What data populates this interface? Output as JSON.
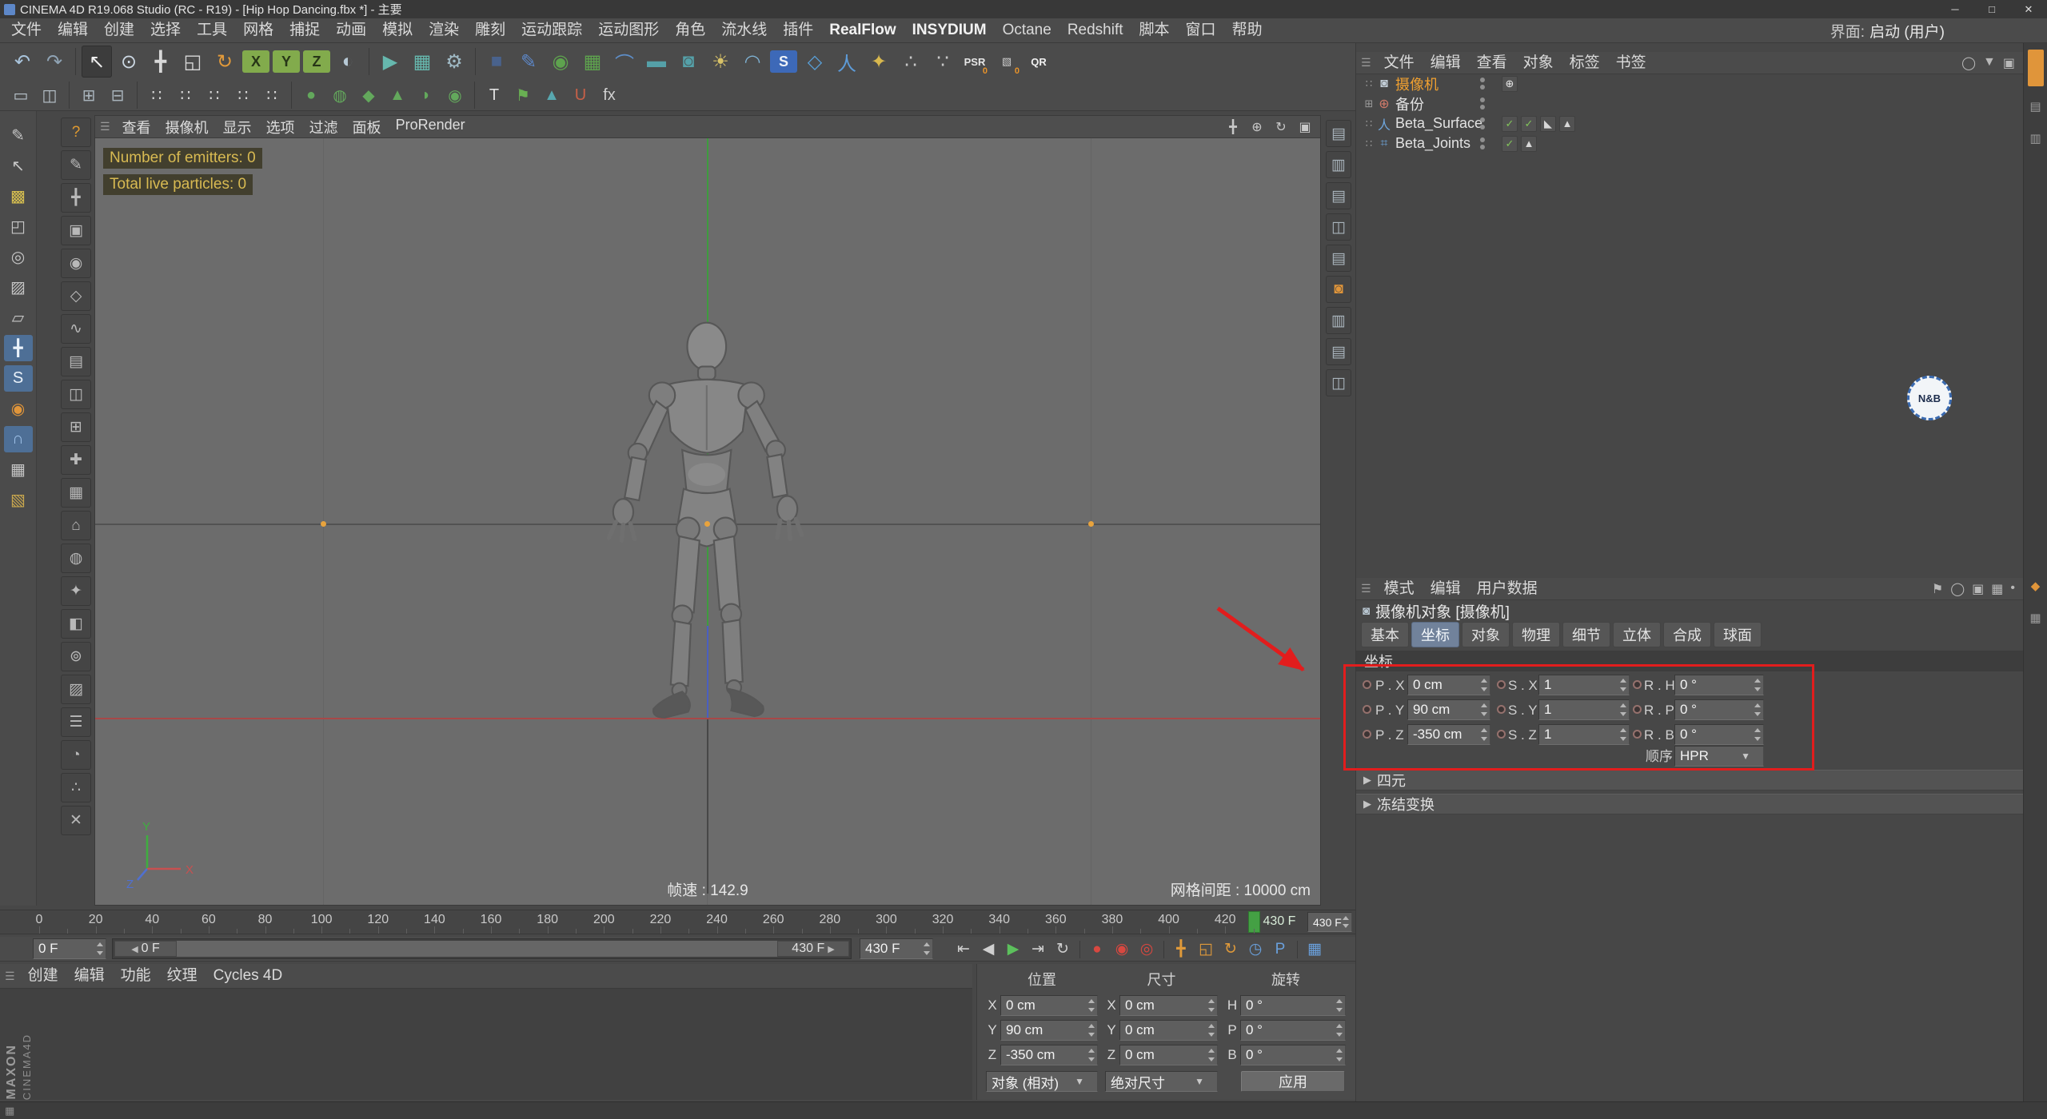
{
  "window": {
    "title": "CINEMA 4D R19.068 Studio (RC - R19) - [Hip Hop Dancing.fbx *] - 主要",
    "buttons": [
      {
        "n": "minimize-button",
        "g": "─"
      },
      {
        "n": "maximize-button",
        "g": "□"
      },
      {
        "n": "close-button",
        "g": "✕"
      }
    ]
  },
  "menubar": {
    "items": [
      "文件",
      "编辑",
      "创建",
      "选择",
      "工具",
      "网格",
      "捕捉",
      "动画",
      "模拟",
      "渲染",
      "雕刻",
      "运动跟踪",
      "运动图形",
      "角色",
      "流水线",
      "插件",
      "RealFlow",
      "INSYDIUM",
      "Octane",
      "Redshift",
      "脚本",
      "窗口",
      "帮助"
    ],
    "emphasis": [
      "RealFlow",
      "INSYDIUM"
    ],
    "interface_label": "界面:",
    "interface_value": "启动 (用户)"
  },
  "toolbar_row1": [
    {
      "n": "undo-icon",
      "g": "↶",
      "c": "#a9c4dc"
    },
    {
      "n": "redo-icon",
      "g": "↷",
      "c": "#8fa3b4"
    },
    {
      "sep": 1
    },
    {
      "n": "select-tool-icon",
      "g": "↖",
      "c": "#f0f0f0",
      "active": 1
    },
    {
      "n": "live-selection-icon",
      "g": "⊙",
      "c": "#cdd9e4"
    },
    {
      "n": "move-tool-icon",
      "g": "╋",
      "c": "#d8d8d8"
    },
    {
      "n": "scale-tool-icon",
      "g": "◱",
      "c": "#d8d8d8"
    },
    {
      "n": "rotate-tool-icon",
      "g": "↻",
      "c": "#e29a3a"
    },
    {
      "n": "x-axis-lock-button",
      "g": "X",
      "bg": "#82ab4c",
      "c": "#273617",
      "btn": 1
    },
    {
      "n": "y-axis-lock-button",
      "g": "Y",
      "bg": "#82ab4c",
      "c": "#273617",
      "btn": 1
    },
    {
      "n": "z-axis-lock-button",
      "g": "Z",
      "bg": "#82ab4c",
      "c": "#273617",
      "btn": 1
    },
    {
      "n": "coordinate-system-icon",
      "g": "◐",
      "c": "#b7c9d6"
    },
    {
      "sep": 1
    },
    {
      "n": "render-view-icon",
      "g": "▶",
      "c": "#66b8ae"
    },
    {
      "n": "render-picture-viewer-icon",
      "g": "▦",
      "c": "#66b8ae"
    },
    {
      "n": "render-settings-icon",
      "g": "⚙",
      "c": "#9fb9c4"
    },
    {
      "sep": 1
    },
    {
      "n": "primitive-cube-icon",
      "g": "■",
      "c": "#49628c"
    },
    {
      "n": "spline-pen-icon",
      "g": "✎",
      "c": "#5d87c8"
    },
    {
      "n": "subdivision-surface-icon",
      "g": "◉",
      "c": "#5ea34e"
    },
    {
      "n": "array-generator-icon",
      "g": "▦",
      "c": "#5ea34e"
    },
    {
      "n": "deformer-icon",
      "g": "⌒",
      "c": "#5e8ec8"
    },
    {
      "n": "floor-object-icon",
      "g": "▬",
      "c": "#55a0a8"
    },
    {
      "n": "camera-object-icon",
      "g": "◙",
      "c": "#55a0a8"
    },
    {
      "n": "light-object-icon",
      "g": "☀",
      "c": "#d8c268"
    },
    {
      "n": "physical-sky-icon",
      "g": "◠",
      "c": "#7fb3d5"
    },
    {
      "n": "simulate-icon",
      "g": "S",
      "bg": "#3d69b8",
      "c": "#eef2f8",
      "btn": 1
    },
    {
      "n": "mograph-icon",
      "g": "◇",
      "c": "#59a0d8"
    },
    {
      "n": "character-object-icon",
      "g": "人",
      "c": "#5d9bd8"
    },
    {
      "n": "joint-tool-icon",
      "g": "✦",
      "c": "#d8b84e"
    },
    {
      "n": "partic​le-emitter-icon",
      "g": "∴",
      "c": "#c9c9c9"
    },
    {
      "n": "thinking-particles-icon",
      "g": "∵",
      "c": "#c9c9c9"
    },
    {
      "n": "psr-badge",
      "g": "PSR",
      "c": "#e6e6e6",
      "badge": 1,
      "sub": "0"
    },
    {
      "n": "xpresso-badge",
      "g": "▧",
      "c": "#cfcfcf",
      "badge": 1,
      "sub": "0"
    },
    {
      "n": "qr-badge",
      "g": "QR",
      "c": "#f0f0f0",
      "badge": 1
    }
  ],
  "toolbar_row2": [
    {
      "n": "layout-single-icon",
      "g": "▭",
      "c": "#b9c4cc"
    },
    {
      "n": "layout-split-icon",
      "g": "◫",
      "c": "#b9c4cc"
    },
    {
      "sep": 1
    },
    {
      "n": "interface-icon-1",
      "g": "⊞",
      "c": "#a9b4bc"
    },
    {
      "n": "interface-icon-2",
      "g": "⊟",
      "c": "#a9b4bc"
    },
    {
      "sep": 1
    },
    {
      "n": "selection-dots-icon-1",
      "g": "∷",
      "c": "#d8d8d8"
    },
    {
      "n": "selection-dots-icon-2",
      "g": "∷",
      "c": "#d8d8d8"
    },
    {
      "n": "selection-dots-icon-3",
      "g": "∷",
      "c": "#d8d8d8"
    },
    {
      "n": "selection-dots-icon-4",
      "g": "∷",
      "c": "#d8d8d8"
    },
    {
      "n": "selection-dots-icon-5",
      "g": "∷",
      "c": "#d8d8d8"
    },
    {
      "sep": 1
    },
    {
      "n": "modeling-preset-icon-1",
      "g": "●",
      "c": "#63a85c"
    },
    {
      "n": "modeling-preset-icon-2",
      "g": "◍",
      "c": "#63a85c"
    },
    {
      "n": "modeling-preset-icon-3",
      "g": "◆",
      "c": "#63a85c"
    },
    {
      "n": "modeling-preset-icon-4",
      "g": "▲",
      "c": "#63a85c"
    },
    {
      "n": "modeling-preset-icon-5",
      "g": "◗",
      "c": "#63a85c"
    },
    {
      "n": "modeling-preset-icon-6",
      "g": "◉",
      "c": "#63a85c"
    },
    {
      "sep": 1
    },
    {
      "n": "text-tool-icon",
      "g": "T",
      "c": "#e0e0e0"
    },
    {
      "n": "flag-icon",
      "g": "⚑",
      "c": "#69b053"
    },
    {
      "n": "cone-icon",
      "g": "▲",
      "c": "#58a8b0"
    },
    {
      "n": "snap-magnet-icon",
      "g": "U",
      "c": "#c86048"
    },
    {
      "n": "fx-icon",
      "g": "fx",
      "c": "#d0d0d0"
    }
  ],
  "left_toolbar": [
    {
      "n": "pen-tool-icon",
      "g": "✎"
    },
    {
      "n": "arrow-annotate-icon",
      "g": "↖"
    },
    {
      "n": "texture-paint-icon",
      "g": "▩",
      "c": "#d8c050"
    },
    {
      "n": "make-editable-icon",
      "g": "◰"
    },
    {
      "n": "model-mode-icon",
      "g": "◎"
    },
    {
      "n": "texture-mode-icon",
      "g": "▨"
    },
    {
      "n": "workplane-icon",
      "g": "▱"
    },
    {
      "n": "axis-mode-icon",
      "g": "╋",
      "active": 1
    },
    {
      "n": "solo-mode-icon",
      "g": "S",
      "active": 1
    },
    {
      "n": "viewport-solo-icon",
      "g": "◉",
      "c": "#e0953a"
    },
    {
      "n": "snap-toggle-icon",
      "g": "∩",
      "active": 1,
      "c": "#9ec1e8"
    },
    {
      "n": "quantize-icon",
      "g": "▦"
    },
    {
      "n": "texture-tile-icon",
      "g": "▧",
      "c": "#caa84e"
    }
  ],
  "palette": [
    {
      "n": "palette-help-icon",
      "g": "?",
      "c": "#e09a30"
    },
    {
      "n": "palette-icon-2",
      "g": "✎"
    },
    {
      "n": "palette-icon-3",
      "g": "╋"
    },
    {
      "n": "palette-icon-4",
      "g": "▣"
    },
    {
      "n": "palette-icon-5",
      "g": "◉"
    },
    {
      "n": "palette-icon-6",
      "g": "◇"
    },
    {
      "n": "palette-icon-7",
      "g": "∿"
    },
    {
      "n": "palette-icon-8",
      "g": "▤"
    },
    {
      "n": "palette-icon-9",
      "g": "◫"
    },
    {
      "n": "palette-icon-10",
      "g": "⊞"
    },
    {
      "n": "palette-icon-11",
      "g": "✚"
    },
    {
      "n": "palette-icon-12",
      "g": "▦"
    },
    {
      "n": "palette-icon-13",
      "g": "⌂"
    },
    {
      "n": "palette-icon-14",
      "g": "◍"
    },
    {
      "n": "palette-icon-15",
      "g": "✦"
    },
    {
      "n": "palette-icon-16",
      "g": "◧"
    },
    {
      "n": "palette-icon-17",
      "g": "⊚"
    },
    {
      "n": "palette-icon-18",
      "g": "▨"
    },
    {
      "n": "palette-icon-19",
      "g": "☰"
    },
    {
      "n": "palette-icon-20",
      "g": "◔"
    },
    {
      "n": "palette-icon-21",
      "g": "∴"
    },
    {
      "n": "palette-icon-22",
      "g": "✕"
    }
  ],
  "side_strip": [
    {
      "n": "panel-tab-icon-1",
      "g": "▤"
    },
    {
      "n": "panel-tab-icon-2",
      "g": "▥"
    },
    {
      "n": "panel-tab-icon-3",
      "g": "▤"
    },
    {
      "n": "panel-tab-icon-4",
      "g": "◫"
    },
    {
      "n": "panel-tab-icon-5",
      "g": "▤"
    },
    {
      "n": "panel-tab-icon-6",
      "g": "◙",
      "c": "#e0953a"
    },
    {
      "n": "panel-tab-icon-7",
      "g": "▥"
    },
    {
      "n": "panel-tab-icon-8",
      "g": "▤"
    },
    {
      "n": "panel-tab-icon-9",
      "g": "◫"
    }
  ],
  "viewport": {
    "menu": [
      "查看",
      "摄像机",
      "显示",
      "选项",
      "过滤",
      "面板",
      "ProRender"
    ],
    "nav_icons": [
      {
        "n": "viewport-pan-icon",
        "g": "╋"
      },
      {
        "n": "viewport-zoom-icon",
        "g": "⊕"
      },
      {
        "n": "viewport-rotate-icon",
        "g": "↻"
      },
      {
        "n": "viewport-toggle-icon",
        "g": "▣"
      }
    ],
    "overlay": [
      "Number of emitters: 0",
      "Total live particles: 0"
    ],
    "fps": "帧速 : 142.9",
    "grid_spacing": "网格间距 : 10000 cm",
    "axis_labels": {
      "x": "X",
      "y": "Y",
      "z": "Z"
    }
  },
  "timeline": {
    "ticks": [
      0,
      20,
      40,
      60,
      80,
      100,
      120,
      140,
      160,
      180,
      200,
      220,
      240,
      260,
      280,
      300,
      320,
      340,
      360,
      380,
      400,
      420
    ],
    "current_frame": 430,
    "current_label": "430 F",
    "start_field": "0 F",
    "end_field": "430 F",
    "end_display": "430 F",
    "range_start_label": "0 F",
    "range_end_label": "430 F",
    "playback": [
      {
        "n": "goto-start-button",
        "g": "⇤"
      },
      {
        "n": "prev-frame-button",
        "g": "◀"
      },
      {
        "n": "play-button",
        "g": "▶",
        "c": "#5cc05c"
      },
      {
        "n": "goto-end-button",
        "g": "⇥"
      },
      {
        "n": "loop-mode-button",
        "g": "↻"
      },
      {
        "sep": 1
      },
      {
        "n": "record-keyframe-button",
        "g": "●",
        "c": "#d84840"
      },
      {
        "n": "autokey-button",
        "g": "◉",
        "c": "#d84840"
      },
      {
        "n": "record-options-button",
        "g": "◎",
        "c": "#d84840"
      },
      {
        "sep": 1
      },
      {
        "n": "record-position-toggle",
        "g": "╋",
        "c": "#e09a3a"
      },
      {
        "n": "record-scale-toggle",
        "g": "◱",
        "c": "#e09a3a"
      },
      {
        "n": "record-rotation-toggle",
        "g": "↻",
        "c": "#e09a3a"
      },
      {
        "n": "record-parameter-toggle",
        "g": "◷",
        "c": "#6aa0dc"
      },
      {
        "n": "record-pla-toggle",
        "g": "P",
        "c": "#6aa0dc"
      },
      {
        "sep": 1
      },
      {
        "n": "timeline-window-button",
        "g": "▦",
        "c": "#6aa0dc"
      }
    ]
  },
  "material_manager": {
    "menu": [
      "创建",
      "编辑",
      "功能",
      "纹理",
      "Cycles 4D"
    ]
  },
  "coordinate_manager": {
    "headers": [
      "位置",
      "尺寸",
      "旋转"
    ],
    "position": [
      [
        "X",
        "0 cm"
      ],
      [
        "Y",
        "90 cm"
      ],
      [
        "Z",
        "-350 cm"
      ]
    ],
    "size": [
      [
        "X",
        "0 cm"
      ],
      [
        "Y",
        "0 cm"
      ],
      [
        "Z",
        "0 cm"
      ]
    ],
    "rotation": [
      [
        "H",
        "0 °"
      ],
      [
        "P",
        "0 °"
      ],
      [
        "B",
        "0 °"
      ]
    ],
    "mode": "对象 (相对)",
    "size_mode": "绝对尺寸",
    "apply": "应用"
  },
  "object_manager": {
    "menu": [
      "文件",
      "编辑",
      "查看",
      "对象",
      "标签",
      "书签"
    ],
    "right_icons": [
      {
        "n": "om-search-icon",
        "g": "◯"
      },
      {
        "n": "om-filter-icon",
        "g": "▼"
      },
      {
        "n": "om-lock-icon",
        "g": "▣"
      }
    ],
    "objects": [
      {
        "name": "摄像机",
        "selected": true,
        "icon": "camera-object-icon",
        "glyph": "◙",
        "color": "#c2cdd6",
        "handle": "∷",
        "tags": [
          {
            "n": "target-tag-icon",
            "g": "⊕",
            "c": "#e8e8e8"
          }
        ]
      },
      {
        "name": "备份",
        "icon": "null-object-icon",
        "glyph": "⊕",
        "color": "#d07a6a",
        "handle": "⊞",
        "tags": []
      },
      {
        "name": "Beta_Surface",
        "icon": "figure-object-icon",
        "glyph": "人",
        "color": "#6fa6dc",
        "handle": "∷",
        "tags": [
          {
            "n": "selection-tag-icon",
            "g": "✓",
            "c": "#82c45a"
          },
          {
            "n": "selection-tag-icon",
            "g": "✓",
            "c": "#82c45a"
          },
          {
            "n": "phong-tag-icon",
            "g": "◣",
            "c": "#d8d8d8"
          },
          {
            "n": "weight-tag-icon",
            "g": "▲",
            "c": "#d8d8d8"
          }
        ]
      },
      {
        "name": "Beta_Joints",
        "icon": "joint-object-icon",
        "glyph": "⌗",
        "color": "#6fa6dc",
        "handle": "∷",
        "tags": [
          {
            "n": "selection-tag-icon",
            "g": "✓",
            "c": "#82c45a"
          },
          {
            "n": "weight-tag-icon",
            "g": "▲",
            "c": "#d8d8d8"
          }
        ]
      }
    ]
  },
  "attribute_manager": {
    "menu": [
      "模式",
      "编辑",
      "用户数据"
    ],
    "right_icons": [
      {
        "n": "am-flag-icon",
        "g": "⚑"
      },
      {
        "n": "am-search-icon",
        "g": "◯"
      },
      {
        "n": "am-lock-icon",
        "g": "▣"
      },
      {
        "n": "am-grid-icon",
        "g": "▦"
      },
      {
        "n": "am-dot-icon",
        "g": "•"
      }
    ],
    "title": "摄像机对象 [摄像机]",
    "tabs": [
      "基本",
      "坐标",
      "对象",
      "物理",
      "细节",
      "立体",
      "合成",
      "球面"
    ],
    "active_tab": "坐标",
    "section": "坐标",
    "rows": [
      {
        "pl": "P . X",
        "pv": "0 cm",
        "sl": "S . X",
        "sv": "1",
        "rl": "R . H",
        "rv": "0 °"
      },
      {
        "pl": "P . Y",
        "pv": "90 cm",
        "sl": "S . Y",
        "sv": "1",
        "rl": "R . P",
        "rv": "0 °"
      },
      {
        "pl": "P . Z",
        "pv": "-350 cm",
        "sl": "S . Z",
        "sv": "1",
        "rl": "R . B",
        "rv": "0 °"
      }
    ],
    "order_label": "顺序",
    "order_value": "HPR",
    "collapsed": [
      "四元",
      "冻结变换"
    ]
  },
  "badge": {
    "text": "N&B"
  },
  "branding": {
    "maxon": "MAXON",
    "cinema": "CINEMA4D"
  },
  "colors": {
    "accent_orange": "#e8892b",
    "selected_text": "#f0a030",
    "axis_green": "#3f9b3f",
    "axis_red": "#a84848",
    "axis_blue": "#4a5fc0",
    "play_green": "#44a044",
    "annotation_red": "#e21d1d"
  }
}
